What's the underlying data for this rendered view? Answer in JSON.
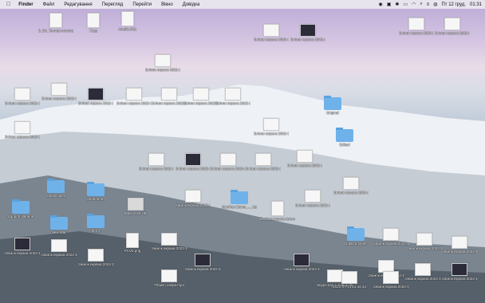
{
  "menubar": {
    "apple": "",
    "app": "Finder",
    "items": [
      "Файл",
      "Редагування",
      "Перегляд",
      "Перейти",
      "Вікно",
      "Довідка"
    ],
    "date": "Пт 12 груд.",
    "time": "01:31"
  },
  "icons": [
    {
      "label": "5_D4_To-mac-running-..._576.avif",
      "kind": "doc"
    },
    {
      "label": "7.jpg",
      "kind": "doc"
    },
    {
      "label": "Amelia 8&1",
      "kind": "doc"
    },
    {
      "label": "Знімок екрана 2022-10...18.31.45",
      "kind": "shot"
    },
    {
      "label": "Знімок екрана 2022-10...14.48.58",
      "kind": "shot"
    },
    {
      "label": "Знімок екрана 2022-12...01.26.56",
      "kind": "shot"
    },
    {
      "label": "Знімок екрана 2022-12...14.02.49",
      "kind": "shot"
    },
    {
      "label": "Знімок екрана 2022-12...14.02.51",
      "kind": "shot"
    },
    {
      "label": "Знімок екрана 2022-10...16.03.03",
      "kind": "shot"
    },
    {
      "label": "Знімок екрана 2022-10...16.37.25",
      "kind": "shot"
    },
    {
      "label": "Знімок екрана 2022-10...14.46.16",
      "kind": "shot"
    },
    {
      "label": "Знімок екрана 2022-10...17.43.37",
      "kind": "shot"
    },
    {
      "label": "Знімок екрана 2022-10...17.43.39",
      "kind": "shot"
    },
    {
      "label": "Знімок екрана 2022-10...16.25.37",
      "kind": "shot"
    },
    {
      "label": "Знімок екрана 2022-10...17.48.28",
      "kind": "shot"
    },
    {
      "label": "Original",
      "kind": "folder"
    },
    {
      "label": "Знімок екрана 2022-10...19.41.27",
      "kind": "shot"
    },
    {
      "label": "Знімок екрана 2022-10...19.48.42",
      "kind": "shot"
    },
    {
      "label": "Edited",
      "kind": "folder"
    },
    {
      "label": "Знімок екрана 2022-10...16.46.35",
      "kind": "shot"
    },
    {
      "label": "Знімок екрана 2022-10...16.47.08",
      "kind": "shot"
    },
    {
      "label": "Знімок екрана 2022-10...16.47.42",
      "kind": "shot"
    },
    {
      "label": "Знімок екрана 2022-10...16.46.49",
      "kind": "shot"
    },
    {
      "label": "Знімок екрана 2022-12...17.10.36",
      "kind": "shot"
    },
    {
      "label": "Знімок екрана 2022-12...8.22.29",
      "kind": "shot"
    },
    {
      "label": "Support Ukraine",
      "kind": "folder"
    },
    {
      "label": "Landscapes",
      "kind": "folder"
    },
    {
      "label": "Оновлення",
      "kind": "folder"
    },
    {
      "label": "Знімок екрана 2022-10...16.48.32",
      "kind": "shot"
    },
    {
      "label": "MacPaw Zoom_..._Крамов",
      "kind": "folder"
    },
    {
      "label": "Вирізка екрана (ownrol).pdf",
      "kind": "doc"
    },
    {
      "label": "Знімок екрана 2022-12...18.48.31",
      "kind": "shot"
    },
    {
      "label": "New Mac",
      "kind": "folder"
    },
    {
      "label": "Macintosh HD",
      "kind": "drive"
    },
    {
      "label": "Фото",
      "kind": "folder"
    },
    {
      "label": "Знімок екрана 2022-10...16.06.50",
      "kind": "shot"
    },
    {
      "label": "Знімок екрана 2022-12...17.57.54",
      "kind": "shot"
    },
    {
      "label": "Знімок екрана 2022-12...17.57.38",
      "kind": "shot"
    },
    {
      "label": "PCV5.png",
      "kind": "doc"
    },
    {
      "label": "Знімок екрана 2022-12...01.40.38",
      "kind": "shot"
    },
    {
      "label": "Знімок екрана 2022-10...16.05.16",
      "kind": "shot"
    },
    {
      "label": "Untitled folder",
      "kind": "folder"
    },
    {
      "label": "Знімок екрана 2022-12...13.49.52",
      "kind": "shot"
    },
    {
      "label": "Знімок екрана 2022-12...17.45.43",
      "kind": "shot"
    },
    {
      "label": "Thawm озера.mp4",
      "kind": "shot"
    },
    {
      "label": "Знімок екрана 2022-12...21.52.40",
      "kind": "shot"
    },
    {
      "label": "Водоспад 1 кінець.mp4",
      "kind": "shot"
    },
    {
      "label": "2022-07-14 14.44.43",
      "kind": "shot"
    },
    {
      "label": "Знімок екрана 2022-12...17.52.20",
      "kind": "shot"
    },
    {
      "label": "Знімок екрана 2022-12...12.13.59",
      "kind": "shot"
    },
    {
      "label": "Знімок екрана 2022-12...18.52.05",
      "kind": "shot"
    },
    {
      "label": "Знімок екрана 2022-12...11.15.02",
      "kind": "shot"
    },
    {
      "label": "Знімок екрана 2022-12...17.12.37",
      "kind": "shot"
    }
  ]
}
